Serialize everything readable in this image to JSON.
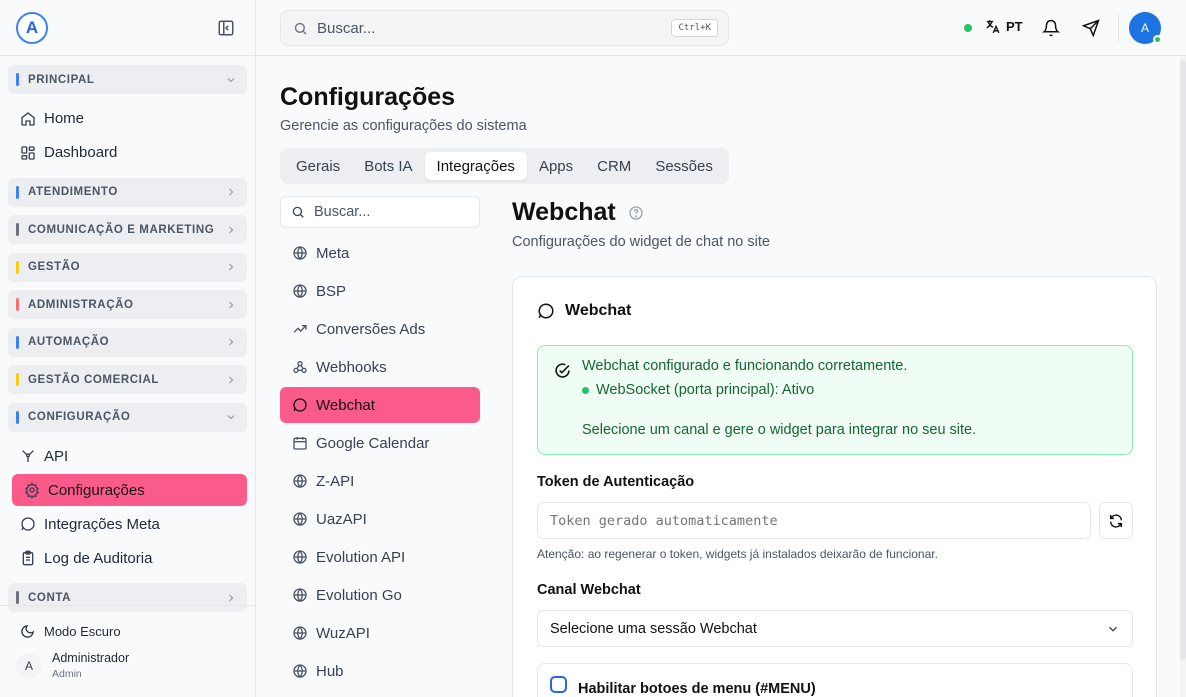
{
  "sidebar": {
    "logo_letter": "A",
    "groups": {
      "principal": {
        "label": "PRINCIPAL",
        "color": "#3b82f6"
      },
      "atendimento": {
        "label": "ATENDIMENTO",
        "color": "#3b82f6"
      },
      "comunicacao": {
        "label": "COMUNICAÇÃO E MARKETING",
        "color": "#6b7280"
      },
      "gestao": {
        "label": "GESTÃO",
        "color": "#facc15"
      },
      "administracao": {
        "label": "ADMINISTRAÇÃO",
        "color": "#f87171"
      },
      "automacao": {
        "label": "AUTOMAÇÃO",
        "color": "#3b82f6"
      },
      "gestao_comercial": {
        "label": "GESTÃO COMERCIAL",
        "color": "#facc15"
      },
      "configuracao": {
        "label": "CONFIGURAÇÃO",
        "color": "#3b82f6"
      },
      "conta": {
        "label": "CONTA",
        "color": "#6b7280"
      }
    },
    "items": {
      "home": "Home",
      "dashboard": "Dashboard",
      "api": "API",
      "configuracoes": "Configurações",
      "integracoes_meta": "Integrações Meta",
      "log_auditoria": "Log de Auditoria"
    },
    "footer": {
      "dark_mode": "Modo Escuro",
      "user_initial": "A",
      "user_name": "Administrador",
      "user_role": "Admin"
    }
  },
  "topbar": {
    "search_placeholder": "Buscar...",
    "shortcut": "Ctrl+K",
    "language": "PT",
    "avatar_initial": "A",
    "status_color": "#22c55e"
  },
  "page": {
    "title": "Configurações",
    "subtitle": "Gerencie as configurações do sistema",
    "tabs": [
      "Gerais",
      "Bots IA",
      "Integrações",
      "Apps",
      "CRM",
      "Sessões"
    ],
    "active_tab": "Integrações"
  },
  "integrations": {
    "search_placeholder": "Buscar...",
    "items": [
      "Meta",
      "BSP",
      "Conversões Ads",
      "Webhooks",
      "Webchat",
      "Google Calendar",
      "Z-API",
      "UazAPI",
      "Evolution API",
      "Evolution Go",
      "WuzAPI",
      "Hub"
    ],
    "active": "Webchat"
  },
  "webchat": {
    "title": "Webchat",
    "subtitle": "Configurações do widget de chat no site",
    "card_title": "Webchat",
    "alert": {
      "line1": "Webchat configurado e funcionando corretamente.",
      "line2": "WebSocket (porta principal): Ativo",
      "line3": "Selecione um canal e gere o widget para integrar no seu site."
    },
    "token_label": "Token de Autenticação",
    "token_placeholder": "Token gerado automaticamente",
    "token_hint": "Atenção: ao regenerar o token, widgets já instalados deixarão de funcionar.",
    "channel_label": "Canal Webchat",
    "channel_value": "Selecione uma sessão Webchat",
    "menu_buttons_label": "Habilitar botoes de menu (#MENU)"
  },
  "colors": {
    "accent": "#fb5b8b",
    "primary": "#1d74e0",
    "success_bg": "#f0fdf4",
    "success_text": "#166534"
  }
}
